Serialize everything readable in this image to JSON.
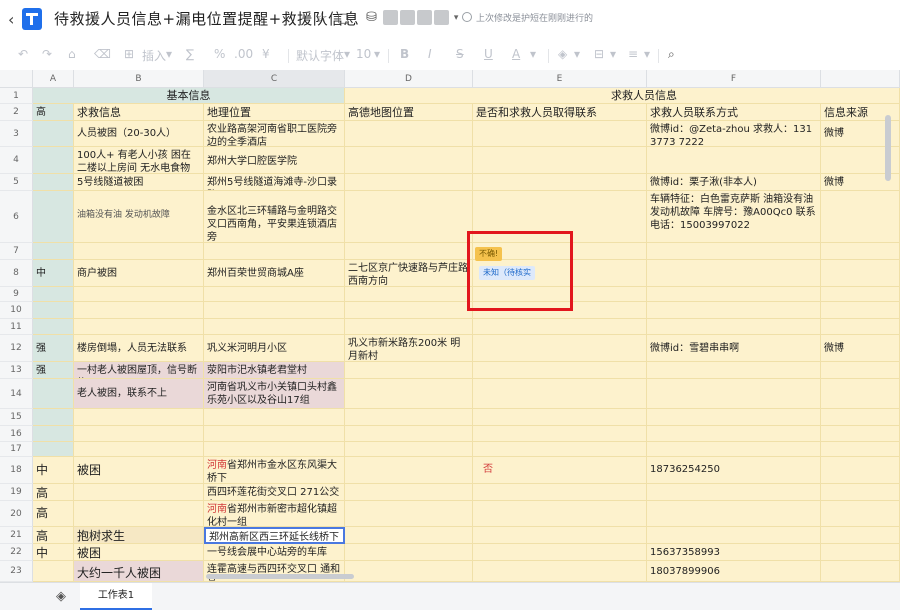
{
  "app": {
    "title": "待救援人员信息+漏电位置提醒+救援队信息",
    "save_state": "上次修改是护短在刚刚进行的"
  },
  "toolbar": {
    "insert": "插入",
    "font": "默认字体",
    "font_size": "10"
  },
  "columns": [
    "A",
    "B",
    "C",
    "D",
    "E",
    "F"
  ],
  "rows": [
    "1",
    "2",
    "3",
    "4",
    "5",
    "6",
    "7",
    "8",
    "9",
    "10",
    "11",
    "12",
    "13",
    "14",
    "15",
    "16",
    "17",
    "18",
    "19",
    "20",
    "21",
    "22",
    "23"
  ],
  "headers": {
    "basic": "基本信息",
    "rescue_people": "求救人员信息",
    "help_info": "求救信息",
    "location": "地理位置",
    "amap": "高德地图位置",
    "contacted": "是否和求救人员取得联系",
    "contact": "求救人员联系方式",
    "source": "信息来源"
  },
  "cells": {
    "a2": "高",
    "b3": "人员被困（20-30人）",
    "c3": "农业路高架河南省职工医院旁边的全季酒店",
    "f3": "微博id：@Zeta-zhou 求救人：131 3773 7222",
    "g3": "微博",
    "b4": "100人+ 有老人小孩 困在二楼以上房间 无水电食物",
    "c4": "郑州大学口腔医学院",
    "b5": "5号线隧道被困",
    "c5": "郑州5号线隧道海滩寺-沙口录路",
    "f5": "微博id：栗子湫(非本人)",
    "g5": "微博",
    "b6": "油箱没有油 发动机故障",
    "c6": "金水区北三环辅路与金明路交叉口西南角，平安果连锁酒店旁",
    "f6": "车辆特征：白色雷克萨斯 油箱没有油 发动机故障 车牌号：豫A00Qc0 联系电话：15003997022",
    "a8": "中",
    "b8": "商户被困",
    "c8": "郑州百荣世贸商城A座",
    "d8": "二七区京广快速路与芦庄路西南方向",
    "a12": "强",
    "b12": "楼房倒塌，人员无法联系",
    "c12": "巩义米河明月小区",
    "d12": "巩义市新米路东200米 明月新村",
    "f12": "微博id：雪碧串串啊",
    "g12": "微博",
    "a13": "强",
    "b13": "一村老人被困屋顶，信号断绝",
    "c13": "荥阳市汜水镇老君堂村",
    "b14": "老人被困，联系不上",
    "c14": "河南省巩义市小关镇口头村鑫乐苑小区以及谷山17组",
    "a18": "中",
    "b18": "被困",
    "c18_red": "河南",
    "c18": "省郑州市金水区东风渠大桥下",
    "e18": "否",
    "f18": "18736254250",
    "a19": "高",
    "c19": "西四环莲花街交叉口 271公交车",
    "a20": "高",
    "c20_red": "河南",
    "c20": "省郑州市新密市超化镇超化村一组",
    "a21": "高",
    "b21": "抱树求生",
    "c21": "郑州高新区西三环延长线桥下",
    "a22": "中",
    "b22": "被困",
    "c22": "一号线会展中心站旁的车库",
    "f22": "15637358993",
    "b23": "大约一千人被困",
    "c23": "连霍高速与西四环交叉口 通和高",
    "f23": "18037899906"
  },
  "tags": {
    "unknown_yes": "不确!",
    "unknown_verify": "未知（待核实"
  },
  "sheet_tab": "工作表1"
}
